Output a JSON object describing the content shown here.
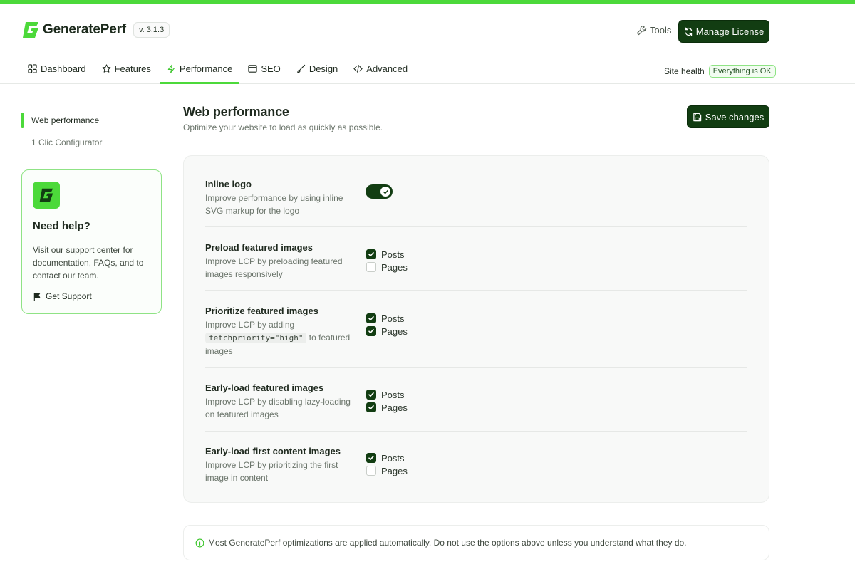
{
  "brand": {
    "name": "GeneratePerf",
    "version": "v. 3.1.3",
    "accent_color": "#4cd93a",
    "primary_color": "#123d12"
  },
  "header": {
    "tools_label": "Tools",
    "license_label": "Manage License",
    "site_health_label": "Site health",
    "site_health_status": "Everything is OK"
  },
  "nav": {
    "tabs": [
      {
        "label": "Dashboard",
        "icon": "grid-icon"
      },
      {
        "label": "Features",
        "icon": "features-icon"
      },
      {
        "label": "Performance",
        "icon": "bolt-icon",
        "active": true
      },
      {
        "label": "SEO",
        "icon": "window-icon"
      },
      {
        "label": "Design",
        "icon": "brush-icon"
      },
      {
        "label": "Advanced",
        "icon": "code-icon"
      }
    ]
  },
  "sidebar": {
    "items": [
      {
        "label": "Web performance",
        "active": true
      },
      {
        "label": "1 Clic Configurator"
      }
    ],
    "help": {
      "title": "Need help?",
      "text": "Visit our support center for documentation, FAQs, and to contact our team.",
      "link_label": "Get Support"
    }
  },
  "main": {
    "title": "Web performance",
    "subtitle": "Optimize your website to load as quickly as possible.",
    "save_label": "Save changes",
    "settings": [
      {
        "label": "Inline logo",
        "description": "Improve performance by using inline SVG markup for the logo",
        "control": "toggle",
        "enabled": true
      },
      {
        "label": "Preload featured images",
        "description": "Improve LCP by preloading featured images responsively",
        "options": [
          {
            "label": "Posts",
            "checked": true
          },
          {
            "label": "Pages",
            "checked": false
          }
        ]
      },
      {
        "label": "Prioritize featured images",
        "description_before": "Improve LCP by adding",
        "description_code": "fetchpriority=\"high\"",
        "description_after": "to featured images",
        "options": [
          {
            "label": "Posts",
            "checked": true
          },
          {
            "label": "Pages",
            "checked": true
          }
        ]
      },
      {
        "label": "Early-load featured images",
        "description": "Improve LCP by disabling lazy-loading on featured images",
        "options": [
          {
            "label": "Posts",
            "checked": true
          },
          {
            "label": "Pages",
            "checked": true
          }
        ]
      },
      {
        "label": "Early-load first content images",
        "description": "Improve LCP by prioritizing the first image in content",
        "options": [
          {
            "label": "Posts",
            "checked": true
          },
          {
            "label": "Pages",
            "checked": false
          }
        ]
      }
    ],
    "notice": "Most GeneratePerf optimizations are applied automatically. Do not use the options above unless you understand what they do."
  }
}
